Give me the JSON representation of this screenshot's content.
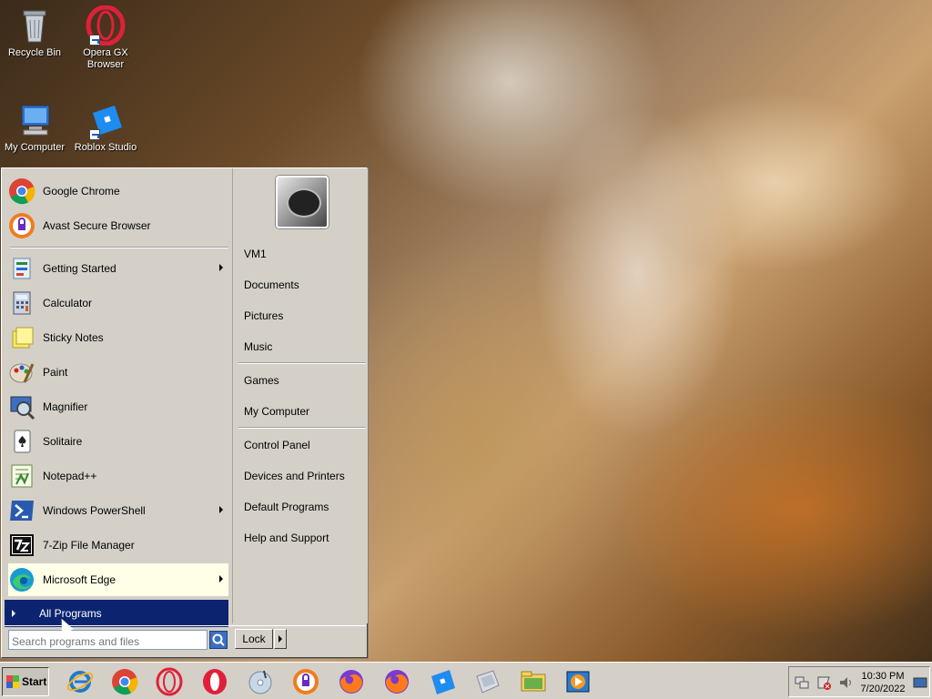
{
  "desktop": {
    "icons": [
      {
        "label": "Recycle Bin",
        "icon": "recycle-bin-icon"
      },
      {
        "label": "Opera GX Browser",
        "icon": "opera-gx-icon"
      },
      {
        "label": "My Computer",
        "icon": "my-computer-icon"
      },
      {
        "label": "Roblox Studio",
        "icon": "roblox-studio-icon"
      }
    ]
  },
  "start_menu": {
    "pinned": [
      {
        "label": "Google Chrome",
        "icon": "chrome-icon"
      },
      {
        "label": "Avast Secure Browser",
        "icon": "avast-browser-icon"
      }
    ],
    "recent": [
      {
        "label": "Getting Started",
        "icon": "getting-started-icon",
        "has_submenu": true
      },
      {
        "label": "Calculator",
        "icon": "calculator-icon"
      },
      {
        "label": "Sticky Notes",
        "icon": "sticky-notes-icon"
      },
      {
        "label": "Paint",
        "icon": "paint-icon"
      },
      {
        "label": "Magnifier",
        "icon": "magnifier-icon"
      },
      {
        "label": "Solitaire",
        "icon": "solitaire-icon"
      },
      {
        "label": "Notepad++",
        "icon": "notepadpp-icon"
      },
      {
        "label": "Windows PowerShell",
        "icon": "powershell-icon",
        "has_submenu": true
      },
      {
        "label": "7-Zip File Manager",
        "icon": "7zip-icon"
      },
      {
        "label": "Microsoft Edge",
        "icon": "edge-icon",
        "has_submenu": true,
        "highlighted": true
      }
    ],
    "all_programs": "All Programs",
    "search_placeholder": "Search programs and files",
    "right_pane": {
      "user": "VM1",
      "group1": [
        "Documents",
        "Pictures",
        "Music"
      ],
      "group2": [
        "Games",
        "My Computer"
      ],
      "group3": [
        "Control Panel",
        "Devices and Printers",
        "Default Programs",
        "Help and Support"
      ]
    },
    "lock_label": "Lock"
  },
  "taskbar": {
    "start_label": "Start",
    "pinned_icons": [
      "internet-explorer-icon",
      "chrome-icon",
      "opera-icon",
      "opera-icon",
      "cd-player-icon",
      "avast-browser-icon",
      "firefox-icon",
      "firefox-icon",
      "roblox-studio-icon",
      "disk-icon",
      "folder-icon",
      "media-player-icon"
    ],
    "clock": {
      "time": "10:30 PM",
      "date": "7/20/2022"
    }
  }
}
